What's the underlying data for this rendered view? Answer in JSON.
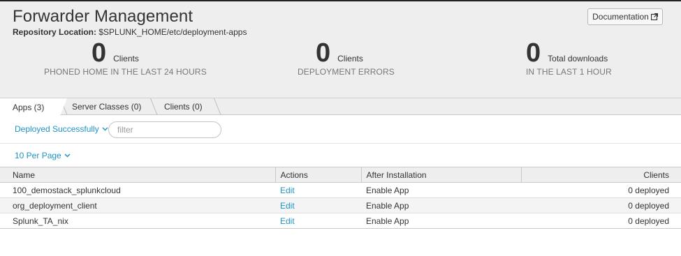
{
  "header": {
    "title": "Forwarder Management",
    "repo_label": "Repository Location:",
    "repo_path": "$SPLUNK_HOME/etc/deployment-apps",
    "doc_button": "Documentation"
  },
  "stats": [
    {
      "value": "0",
      "unit": "Clients",
      "sub": "PHONED HOME IN THE LAST 24 HOURS"
    },
    {
      "value": "0",
      "unit": "Clients",
      "sub": "DEPLOYMENT ERRORS"
    },
    {
      "value": "0",
      "unit": "Total downloads",
      "sub": "IN THE LAST 1 HOUR"
    }
  ],
  "tabs": [
    {
      "label": "Apps (3)",
      "active": true
    },
    {
      "label": "Server Classes (0)",
      "active": false
    },
    {
      "label": "Clients (0)",
      "active": false
    }
  ],
  "filters": {
    "status_dropdown": "Deployed Successfully",
    "filter_placeholder": "filter",
    "per_page": "10 Per Page"
  },
  "table": {
    "columns": [
      "Name",
      "Actions",
      "After Installation",
      "Clients"
    ],
    "rows": [
      {
        "name": "100_demostack_splunkcloud",
        "action": "Edit",
        "after": "Enable App",
        "clients": "0 deployed"
      },
      {
        "name": "org_deployment_client",
        "action": "Edit",
        "after": "Enable App",
        "clients": "0 deployed"
      },
      {
        "name": "Splunk_TA_nix",
        "action": "Edit",
        "after": "Enable App",
        "clients": "0 deployed"
      }
    ]
  },
  "colors": {
    "accent_link": "#1e93c6",
    "header_bg": "#eeeeee",
    "text": "#333333"
  },
  "icons": {
    "doc_button_icon": "external-link-icon",
    "dropdown_icon": "chevron-down-icon"
  }
}
